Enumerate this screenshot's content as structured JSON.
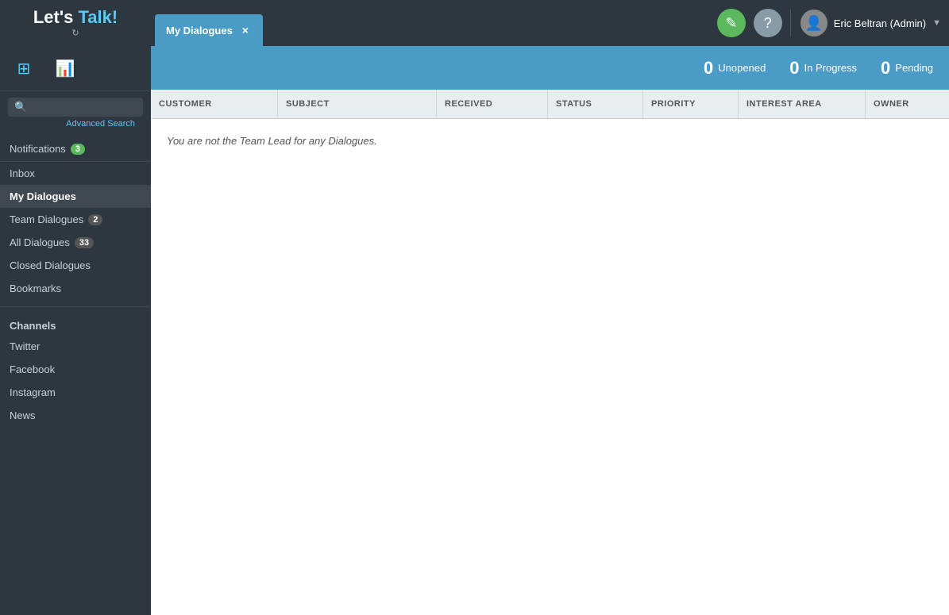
{
  "app": {
    "name": "Let's Talk!"
  },
  "topbar": {
    "tab_label": "My Dialogues",
    "tab_close": "×",
    "edit_icon": "✎",
    "help_icon": "?",
    "user_name": "Eric Beltran (Admin)",
    "user_chevron": "▼"
  },
  "stats": {
    "unopened_count": "0",
    "unopened_label": "Unopened",
    "inprogress_count": "0",
    "inprogress_label": "In Progress",
    "pending_count": "0",
    "pending_label": "Pending"
  },
  "table": {
    "columns": [
      "CUSTOMER",
      "SUBJECT",
      "RECEIVED",
      "STATUS",
      "PRIORITY",
      "INTEREST AREA",
      "OWNER"
    ],
    "empty_message": "You are not the Team Lead for any Dialogues."
  },
  "sidebar": {
    "search_placeholder": "",
    "advanced_search": "Advanced Search",
    "notifications_label": "Notifications",
    "notifications_count": "3",
    "inbox_label": "Inbox",
    "my_dialogues_label": "My Dialogues",
    "team_dialogues_label": "Team Dialogues",
    "team_dialogues_count": "2",
    "all_dialogues_label": "All Dialogues",
    "all_dialogues_count": "33",
    "closed_dialogues_label": "Closed Dialogues",
    "bookmarks_label": "Bookmarks",
    "channels_label": "Channels",
    "twitter_label": "Twitter",
    "facebook_label": "Facebook",
    "instagram_label": "Instagram",
    "news_label": "News"
  }
}
